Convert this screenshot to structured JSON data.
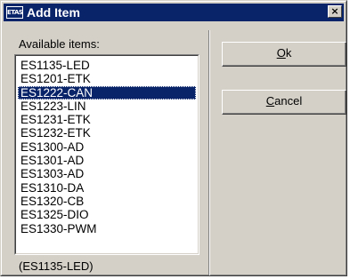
{
  "window": {
    "title": "Add Item",
    "icon_label": "ETAS",
    "close_label": "×"
  },
  "available_label": "Available items:",
  "items": [
    "ES1135-LED",
    "ES1201-ETK",
    "ES1222-CAN",
    "ES1223-LIN",
    "ES1231-ETK",
    "ES1232-ETK",
    "ES1300-AD",
    "ES1301-AD",
    "ES1303-AD",
    "ES1310-DA",
    "ES1320-CB",
    "ES1325-DIO",
    "ES1330-PWM"
  ],
  "selected_item": "ES1222-CAN",
  "status_text": "(ES1135-LED)",
  "buttons": {
    "ok_accel": "O",
    "ok_rest": "k",
    "cancel_accel": "C",
    "cancel_rest": "ancel"
  }
}
